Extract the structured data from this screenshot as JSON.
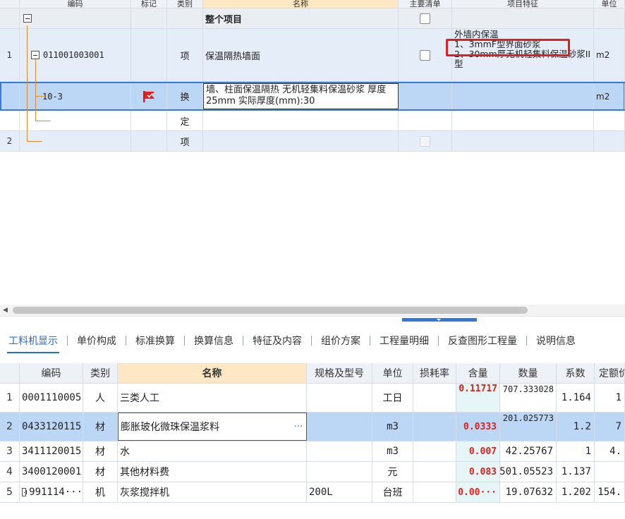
{
  "upper_grid": {
    "headers": {
      "code": "编码",
      "mark": "标记",
      "type": "类别",
      "name": "名称",
      "main_list": "主要清单",
      "features": "项目特征",
      "unit": "单位"
    },
    "project_row": {
      "label": "整个项目"
    },
    "rows": [
      {
        "num": "1",
        "code": "011001003001",
        "type": "项",
        "name": "保温隔热墙面",
        "features": "外墙内保温\n1、3mmF型界面砂浆\n2、30mm厚无机轻集料保温砂浆II型",
        "unit": "m2"
      },
      {
        "num": "",
        "code": "10-3",
        "type": "换",
        "name": "墙、柱面保温隔热 无机轻集料保温砂浆 厚度25mm  实际厚度(mm):30",
        "features": "",
        "unit": "m2"
      },
      {
        "num": "",
        "code": "",
        "type": "定",
        "name": "",
        "features": "",
        "unit": ""
      },
      {
        "num": "2",
        "code": "",
        "type": "项",
        "name": "",
        "features": "",
        "unit": ""
      }
    ]
  },
  "tabs": [
    "工料机显示",
    "单价构成",
    "标准换算",
    "换算信息",
    "特征及内容",
    "组价方案",
    "工程量明细",
    "反查图形工程量",
    "说明信息"
  ],
  "active_tab": "工料机显示",
  "lower_grid": {
    "headers": [
      "编码",
      "类别",
      "名称",
      "规格及型号",
      "单位",
      "损耗率",
      "含量",
      "数量",
      "系数",
      "定额价"
    ],
    "rows": [
      {
        "num": "1",
        "code": "0001110005",
        "type": "人",
        "name": "三类人工",
        "spec": "",
        "unit": "工日",
        "loss": "",
        "qty": "0.11717",
        "amount": "707.333028",
        "coef": "1.164",
        "price": "1"
      },
      {
        "num": "2",
        "code": "0433120115",
        "type": "材",
        "name": "膨胀玻化微珠保温浆料",
        "spec": "",
        "unit": "m3",
        "loss": "",
        "qty": "0.0333",
        "amount": "201.025773",
        "coef": "1.2",
        "price": "7"
      },
      {
        "num": "3",
        "code": "3411120015",
        "type": "材",
        "name": "水",
        "spec": "",
        "unit": "m3",
        "loss": "",
        "qty": "0.007",
        "amount": "42.25767",
        "coef": "1",
        "price": "4."
      },
      {
        "num": "4",
        "code": "3400120001",
        "type": "材",
        "name": "其他材料费",
        "spec": "",
        "unit": "元",
        "loss": "",
        "qty": "0.083",
        "amount": "501.05523",
        "coef": "1.137",
        "price": ""
      },
      {
        "num": "5",
        "code": "991114···",
        "type": "机",
        "name": "灰浆搅拌机",
        "spec": "200L",
        "unit": "台班",
        "loss": "",
        "qty": "0.00···",
        "amount": "19.07632",
        "coef": "1.202",
        "price": "154."
      }
    ]
  },
  "colors": {
    "accent": "#1f6fd1",
    "highlight_red": "#e0201c",
    "selection": "#bcd6f5",
    "tree_line": "#e08a2a"
  }
}
